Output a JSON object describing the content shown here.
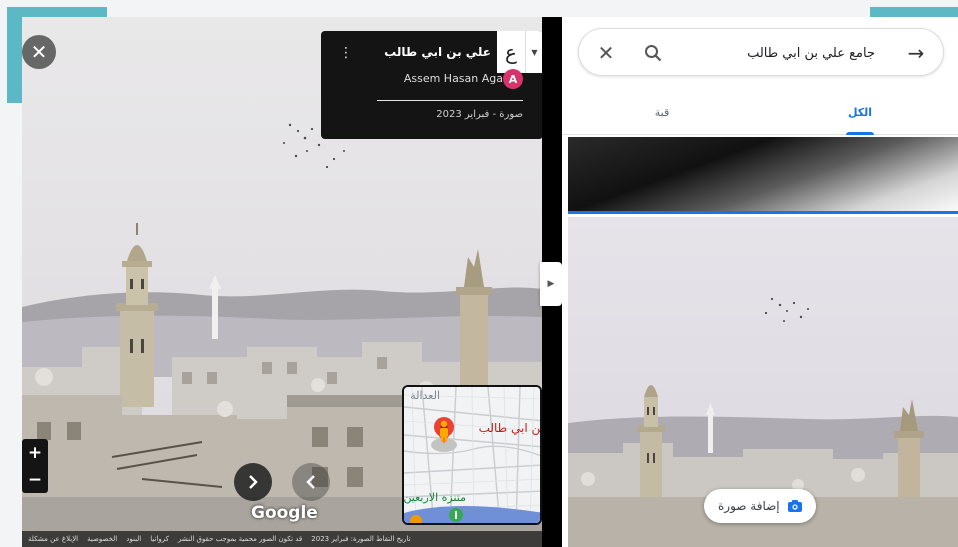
{
  "street_view": {
    "card": {
      "place_name": "علي بن ابي طالب",
      "author": "Assem Hasan Aga",
      "author_initial": "A",
      "date": "صورة - فبراير 2023",
      "nav_glyph": "ع"
    },
    "brand": "Google",
    "minimap": {
      "label_top": "العدالة",
      "label_place": "بن ابي طالب",
      "label_bottom": "متنزه الاربعين"
    },
    "legal_links": [
      "تاريخ التقاط الصورة: فبراير 2023",
      "قد تكون الصور محمية بموجب حقوق النشر",
      "كرواتيا",
      "البنود",
      "الخصوصية",
      "الإبلاغ عن مشكلة"
    ],
    "icons": {
      "close": "close-icon",
      "zoom_in": "plus-icon",
      "zoom_out": "minus-icon",
      "next": "chevron-right-icon",
      "prev": "chevron-left-icon",
      "more": "more-vert-icon"
    }
  },
  "panel": {
    "search": {
      "query": "جامع علي بن ابي طالب"
    },
    "tabs": [
      {
        "label": "الكل",
        "active": true
      },
      {
        "label": "قبة",
        "active": false
      }
    ],
    "add_photo_label": "إضافة صورة"
  },
  "colors": {
    "accent_blue": "#1a73e8",
    "frame_teal": "#5bb8c4",
    "avatar": "#d8336b",
    "pin_red": "#ea4335",
    "pegman": "#f9ab00",
    "park_green": "#34a853"
  }
}
